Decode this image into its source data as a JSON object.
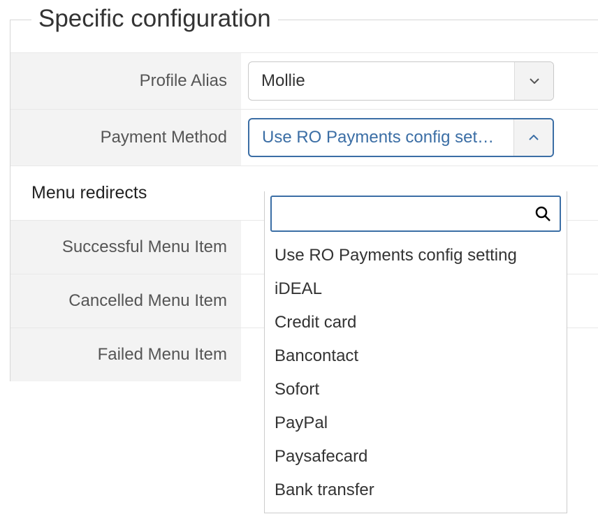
{
  "fieldset": {
    "legend": "Specific configuration"
  },
  "profile_alias": {
    "label": "Profile Alias",
    "value": "Mollie"
  },
  "payment_method": {
    "label": "Payment Method",
    "selected_display": "Use RO Payments config set…",
    "search_value": "",
    "options": [
      "Use RO Payments config setting",
      "iDEAL",
      "Credit card",
      "Bancontact",
      "Sofort",
      "PayPal",
      "Paysafecard",
      "Bank transfer"
    ]
  },
  "menu_redirects": {
    "heading": "Menu redirects",
    "successful_label": "Successful Menu Item",
    "cancelled_label": "Cancelled Menu Item",
    "failed_label": "Failed Menu Item"
  }
}
